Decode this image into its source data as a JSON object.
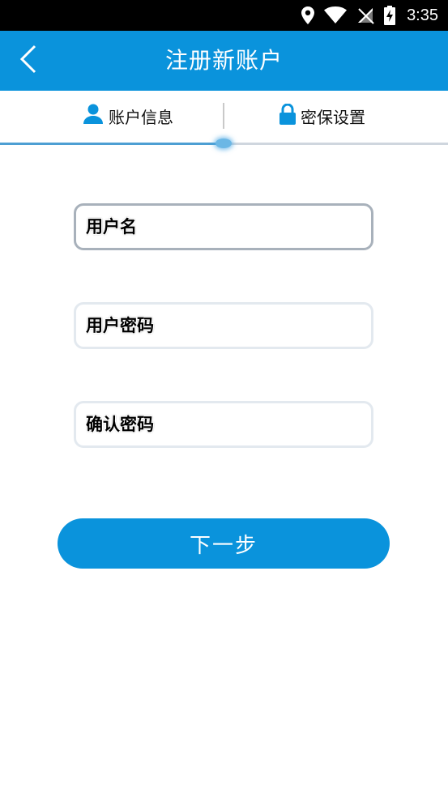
{
  "status_bar": {
    "time": "3:35",
    "icons": [
      "location-icon",
      "wifi-icon",
      "no-sim-icon",
      "battery-charging-icon"
    ]
  },
  "app_bar": {
    "title": "注册新账户",
    "back_icon": "chevron-left-icon"
  },
  "tabs": [
    {
      "label": "账户信息",
      "icon": "person-icon",
      "active": true
    },
    {
      "label": "密保设置",
      "icon": "lock-icon",
      "active": false
    }
  ],
  "progress": {
    "fraction": 0.5
  },
  "form": {
    "username_placeholder": "用户名",
    "password_placeholder": "用户密码",
    "confirm_placeholder": "确认密码",
    "username_value": "",
    "password_value": "",
    "confirm_value": ""
  },
  "next_button_label": "下一步",
  "colors": {
    "primary": "#0a93dc",
    "progress": "#4d9fd3",
    "divider": "#c9c9c9"
  }
}
